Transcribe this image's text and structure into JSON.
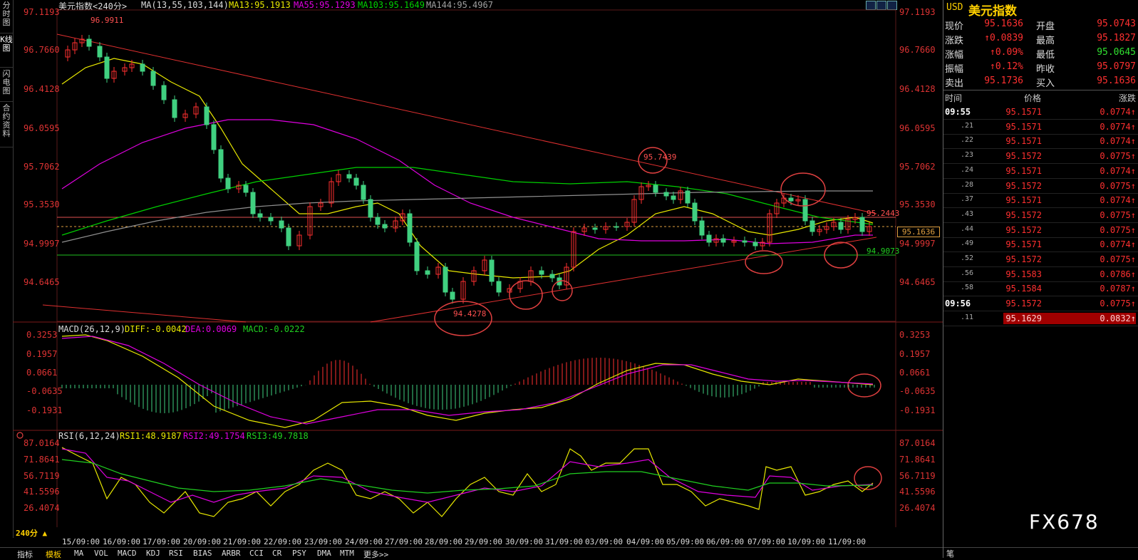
{
  "left_tabs": [
    "分时图",
    "K线图",
    "闪电图",
    "合约资料"
  ],
  "header": {
    "symbol": "美元指数",
    "period": "<240分>",
    "ma_params": "MA(13,55,103,144)",
    "ma13": "MA13:95.1913",
    "ma55": "MA55:95.1293",
    "ma103": "MA103:95.1649",
    "ma144": "MA144:95.4967",
    "colors": {
      "ma13": "#e8e800",
      "ma55": "#e000e0",
      "ma103": "#00d000",
      "ma144": "#909090",
      "up": "#ff3030",
      "down": "#40d080"
    }
  },
  "price_axis": [
    "97.1193",
    "96.7660",
    "96.4128",
    "96.0595",
    "95.7062",
    "95.3530",
    "94.9997",
    "94.6465"
  ],
  "annotations": {
    "high": "96.9911",
    "peak2": "95.7439",
    "low": "94.4278",
    "resistance": "95.2443",
    "support": "94.9073",
    "current": "95.1636"
  },
  "macd": {
    "header": "MACD(26,12,9)",
    "diff": "DIFF:-0.0042",
    "dea": "DEA:0.0069",
    "macd": "MACD:-0.0222",
    "axis": [
      "0.3253",
      "0.1957",
      "0.0661",
      "-0.0635",
      "-0.1931"
    ]
  },
  "rsi": {
    "header": "RSI(6,12,24)",
    "rsi1": "RSI1:48.9187",
    "rsi2": "RSI2:49.1754",
    "rsi3": "RSI3:49.7818",
    "axis": [
      "87.0164",
      "71.8641",
      "56.7119",
      "41.5596",
      "26.4074"
    ]
  },
  "dates": [
    "15/09:00",
    "16/09:00",
    "17/09:00",
    "20/09:00",
    "21/09:00",
    "22/09:00",
    "23/09:00",
    "24/09:00",
    "27/09:00",
    "28/09:00",
    "29/09:00",
    "30/09:00",
    "31/09:00",
    "03/09:00",
    "04/09:00",
    "05/09:00",
    "06/09:00",
    "07/09:00",
    "10/09:00",
    "11/09:00"
  ],
  "bottom_tabs": [
    "240分 ▲",
    "指标",
    "模板",
    "MA",
    "VOL",
    "MACD",
    "KDJ",
    "RSI",
    "BIAS",
    "ARBR",
    "CCI",
    "CR",
    "PSY",
    "DMA",
    "MTM",
    "更多>>"
  ],
  "quote": {
    "title_code": "USD",
    "title_name": "美元指数",
    "rows": [
      {
        "l1": "现价",
        "v1": "95.1636",
        "l2": "开盘",
        "v2": "95.0743"
      },
      {
        "l1": "涨跌",
        "v1": "↑0.0839",
        "l2": "最高",
        "v2": "95.1827"
      },
      {
        "l1": "涨幅",
        "v1": "↑0.09%",
        "l2": "最低",
        "v2": "95.0645"
      },
      {
        "l1": "振幅",
        "v1": "↑0.12%",
        "l2": "昨收",
        "v2": "95.0797"
      },
      {
        "l1": "卖出",
        "v1": "95.1736",
        "l2": "买入",
        "v2": "95.1636"
      }
    ],
    "tick_header": {
      "time": "时间",
      "price": "价格",
      "change": "涨跌"
    },
    "ticks": [
      {
        "t": "09:55",
        "p": "95.1571",
        "c": "0.0774↑"
      },
      {
        "t": ".21",
        "p": "95.1571",
        "c": "0.0774↑"
      },
      {
        "t": ".22",
        "p": "95.1571",
        "c": "0.0774↑"
      },
      {
        "t": ".23",
        "p": "95.1572",
        "c": "0.0775↑"
      },
      {
        "t": ".24",
        "p": "95.1571",
        "c": "0.0774↑"
      },
      {
        "t": ".28",
        "p": "95.1572",
        "c": "0.0775↑"
      },
      {
        "t": ".37",
        "p": "95.1571",
        "c": "0.0774↑"
      },
      {
        "t": ".43",
        "p": "95.1572",
        "c": "0.0775↑"
      },
      {
        "t": ".44",
        "p": "95.1572",
        "c": "0.0775↑"
      },
      {
        "t": ".49",
        "p": "95.1571",
        "c": "0.0774↑"
      },
      {
        "t": ".52",
        "p": "95.1572",
        "c": "0.0775↑"
      },
      {
        "t": ".56",
        "p": "95.1583",
        "c": "0.0786↑"
      },
      {
        "t": ".58",
        "p": "95.1584",
        "c": "0.0787↑"
      },
      {
        "t": "09:56",
        "p": "95.1572",
        "c": "0.0775↑"
      },
      {
        "t": ".11",
        "p": "95.1629",
        "c": "0.0832↑"
      }
    ],
    "bottom_tab": "笔"
  },
  "watermark": "FX678"
}
